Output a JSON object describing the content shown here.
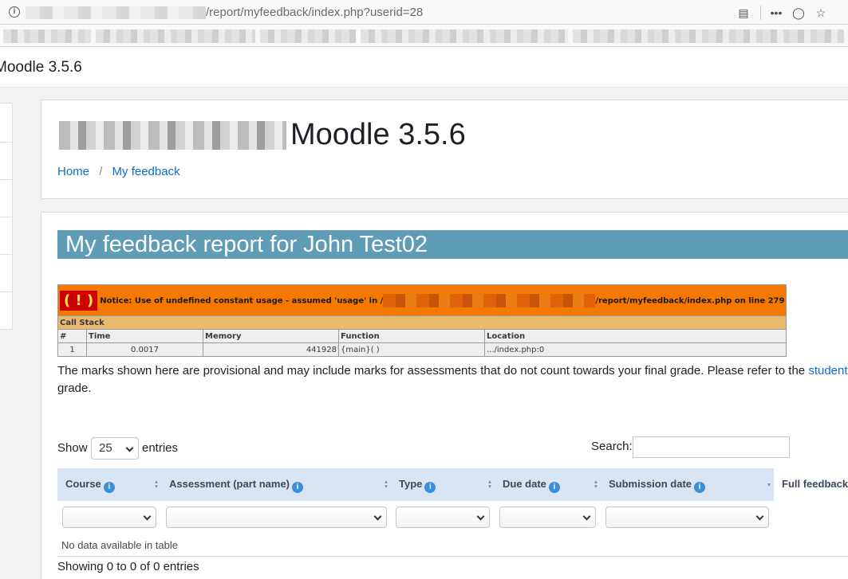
{
  "browser": {
    "url": "/report/myfeedback/index.php?userid=28",
    "menu_icon": "ellipsis-icon",
    "pocket_icon": "pocket-icon",
    "star_icon": "bookmark-star-icon",
    "reader_icon": "reader-view-icon"
  },
  "navbar": {
    "brand": "Moodle 3.5.6"
  },
  "header": {
    "site_title": "Moodle 3.5.6",
    "breadcrumb": [
      {
        "label": "Home"
      },
      {
        "label": "My feedback"
      }
    ],
    "breadcrumb_separator": "/"
  },
  "report": {
    "title": "My feedback report for John Test02",
    "title_bg": "#5f9cb5"
  },
  "xdebug": {
    "bang": "( ! )",
    "notice_prefix": "Notice: Use of undefined constant usage - assumed 'usage' in /",
    "notice_suffix": "/report/myfeedback/index.php on line 279",
    "call_stack": "Call Stack",
    "columns": [
      "#",
      "Time",
      "Memory",
      "Function",
      "Location"
    ],
    "rows": [
      {
        "num": "1",
        "time": "0.0017",
        "memory": "441928",
        "function": "{main}( )",
        "location": ".../index.php:0"
      }
    ]
  },
  "notice": {
    "text_before": "The marks shown here are provisional and may include marks for assessments that do not count towards your final grade. Please refer to the ",
    "link": "student re",
    "text_after": "grade."
  },
  "table_controls": {
    "show_label": "Show",
    "page_size": "25",
    "entries_label": "entries",
    "search_label": "Search:",
    "search_value": ""
  },
  "columns": [
    {
      "label": "Course"
    },
    {
      "label": "Assessment (part name)"
    },
    {
      "label": "Type"
    },
    {
      "label": "Due date"
    },
    {
      "label": "Submission date"
    },
    {
      "label": "Full feedback"
    }
  ],
  "table": {
    "empty_message": "No data available in table",
    "info": "Showing 0 to 0 of 0 entries"
  },
  "colors": {
    "link": "#0f6fc5",
    "header_row": "#d9e5f2",
    "xdebug_notice": "#f57900",
    "xdebug_callstack": "#e9b96e"
  }
}
